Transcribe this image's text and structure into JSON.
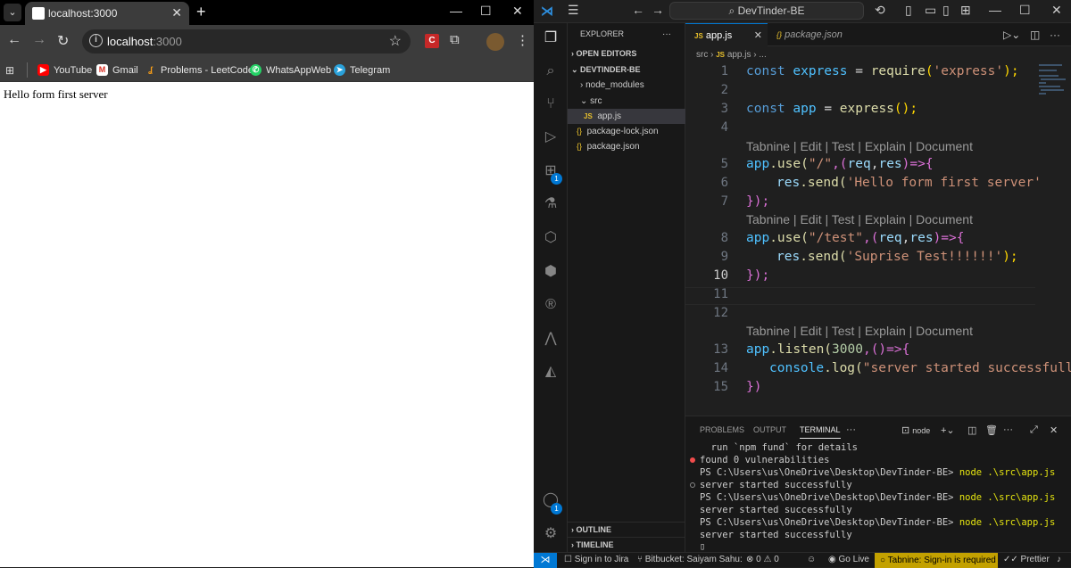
{
  "chrome": {
    "tab_title": "localhost:3000",
    "url_host": "localhost",
    "url_port": ":3000",
    "bookmarks": [
      "YouTube",
      "Gmail",
      "Problems - LeetCode",
      "WhatsAppWeb",
      "Telegram"
    ],
    "page_text": "Hello form first server"
  },
  "vscode": {
    "search_text": "DevTinder-BE",
    "explorer": {
      "title": "EXPLORER",
      "open_editors": "OPEN EDITORS",
      "project": "DEVTINDER-BE",
      "items": [
        "node_modules",
        "src",
        "app.js",
        "package-lock.json",
        "package.json"
      ],
      "outline": "OUTLINE",
      "timeline": "TIMELINE"
    },
    "tabs": [
      "app.js",
      "package.json"
    ],
    "breadcrumb": [
      "src",
      "app.js",
      "..."
    ],
    "code_lens": "Tabnine | Edit | Test | Explain | Document",
    "line_numbers": [
      "1",
      "2",
      "3",
      "4",
      "5",
      "6",
      "7",
      "8",
      "9",
      "10",
      "11",
      "12",
      "13",
      "14",
      "15"
    ],
    "code": {
      "l1": [
        "const",
        "express",
        "=",
        "require",
        "(",
        "'express'",
        ");"
      ],
      "l3": [
        "const",
        "app",
        "=",
        "express",
        "();"
      ],
      "l5": [
        "app",
        ".use(",
        "\"/\"",
        ",(",
        "req",
        ",",
        "res",
        ")=>{"
      ],
      "l6": [
        "res",
        ".send(",
        "'Hello form first server'"
      ],
      "l7": [
        "});"
      ],
      "l8": [
        "app",
        ".use(",
        "\"/test\"",
        ",(",
        "req",
        ",",
        "res",
        ")=>{"
      ],
      "l9": [
        "res",
        ".send(",
        "'Suprise Test!!!!!!'",
        ");"
      ],
      "l10": [
        "});"
      ],
      "l13": [
        "app",
        ".listen(",
        "3000",
        ",()=>{"
      ],
      "l14": [
        "console",
        ".log(",
        "\"server started successfully\""
      ],
      "l15": [
        "})"
      ]
    },
    "panel": {
      "tabs": [
        "PROBLEMS",
        "OUTPUT",
        "TERMINAL"
      ],
      "shell": "node",
      "lines": [
        "  run `npm fund` for details",
        "found 0 vulnerabilities",
        "PS C:\\Users\\us\\OneDrive\\Desktop\\DevTinder-BE>",
        "server started successfully",
        "PS C:\\Users\\us\\OneDrive\\Desktop\\DevTinder-BE>",
        "server started successfully",
        "PS C:\\Users\\us\\OneDrive\\Desktop\\DevTinder-BE>",
        "server started successfully"
      ],
      "cmd": "node .\\src\\app.js"
    },
    "status": {
      "jira": "Sign in to Jira",
      "bitbucket": "Bitbucket: Saiyam Sahu:",
      "problems": "0 ⚠ 0",
      "golive": "Go Live",
      "tabnine": "Tabnine: Sign-in is required",
      "prettier": "Prettier"
    },
    "badge_extensions": "1",
    "badge_accounts": "1"
  }
}
